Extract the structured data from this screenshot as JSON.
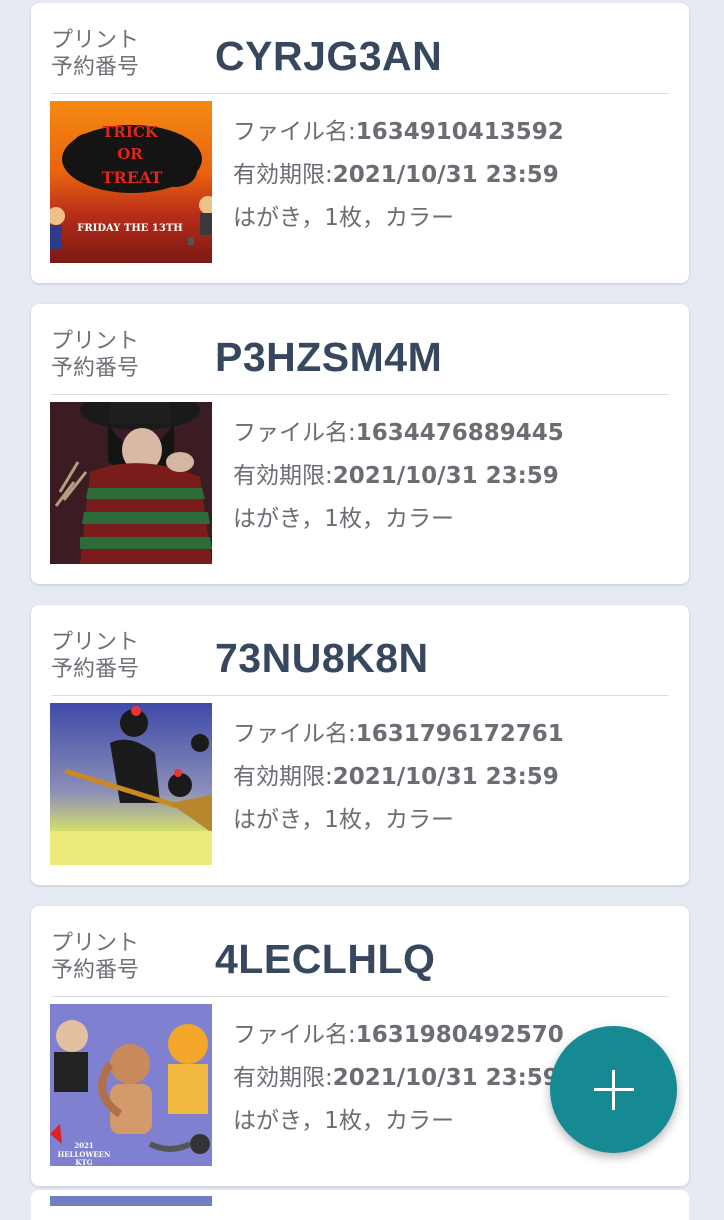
{
  "reservations": [
    {
      "label": "プリント\n予約番号",
      "code": "CYRJG3AN",
      "filename_label": "ファイル名:",
      "filename": "1634910413592",
      "expiry_label": "有効期限:",
      "expiry": "2021/10/31 23:59",
      "spec": "はがき，1枚，カラー",
      "thumbnail": "trick-or-treat-friday-the-13th-image",
      "thumbnail_text": "TRICK OR TREAT",
      "thumbnail_subtext": "FRIDAY THE 13TH"
    },
    {
      "label": "プリント\n予約番号",
      "code": "P3HZSM4M",
      "filename_label": "ファイル名:",
      "filename": "1634476889445",
      "expiry_label": "有効期限:",
      "expiry": "2021/10/31 23:59",
      "spec": "はがき，1枚，カラー",
      "thumbnail": "striped-sweater-claw-character-image"
    },
    {
      "label": "プリント\n予約番号",
      "code": "73NU8K8N",
      "filename_label": "ファイル名:",
      "filename": "1631796172761",
      "expiry_label": "有効期限:",
      "expiry": "2021/10/31 23:59",
      "spec": "はがき，1枚，カラー",
      "thumbnail": "witch-on-broom-image"
    },
    {
      "label": "プリント\n予約番号",
      "code": "4LECLHLQ",
      "filename_label": "ファイル名:",
      "filename": "1631980492570",
      "expiry_label": "有効期限:",
      "expiry": "2021/10/31 23:59",
      "spec": "はがき，1枚，カラー",
      "thumbnail": "halloween-costume-characters-image",
      "thumbnail_text": "2021 HELLOWEEN KTG"
    }
  ],
  "fab": {
    "icon": "plus-icon",
    "color": "#168a93"
  },
  "colors": {
    "background": "#e6ebf3",
    "code_text": "#36475e",
    "muted_text": "#6a6e74"
  }
}
